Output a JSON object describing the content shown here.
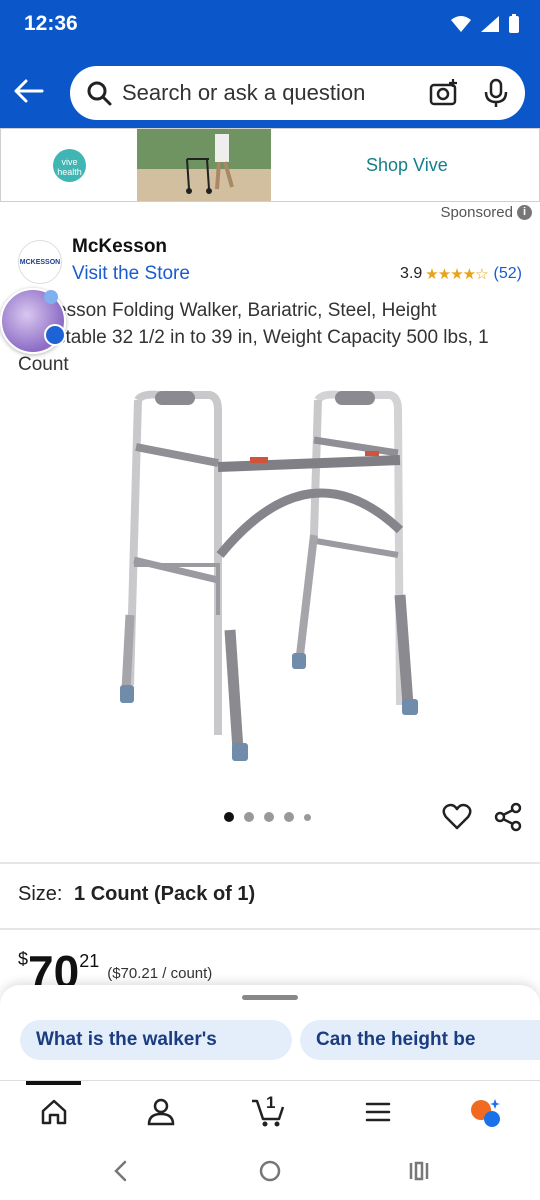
{
  "status_bar": {
    "time": "12:36"
  },
  "header": {
    "search_placeholder": "Search or ask a question"
  },
  "ad": {
    "brand_logo_text": "vive health",
    "cta": "Shop Vive",
    "sponsored_label": "Sponsored"
  },
  "seller": {
    "logo_text": "MCKESSON",
    "name": "McKesson",
    "link": "Visit the Store"
  },
  "rating": {
    "score": "3.9",
    "stars": "★★★★☆",
    "count": "(52)"
  },
  "product": {
    "title": "McKesson Folding Walker, Bariatric, Steel, Height Adjustable 32 1/2 in to 39 in, Weight Capacity 500 lbs, 1 Count",
    "image_count": 5,
    "active_image": 1
  },
  "size": {
    "label": "Size:",
    "value": "1 Count (Pack of 1)"
  },
  "price": {
    "currency": "$",
    "whole": "70",
    "cents": "21",
    "unit_price": "($70.21 / count)"
  },
  "assistant_chips": [
    {
      "label": "What is the walker's"
    },
    {
      "label": "Can the height be"
    }
  ],
  "bottom_nav": {
    "cart_count": "1",
    "items": [
      "home-icon",
      "account-icon",
      "cart-icon",
      "menu-icon",
      "assistant-icon"
    ]
  },
  "colors": {
    "header_blue": "#0b57c9",
    "link_blue": "#1a5bd0",
    "star_yellow": "#e8a317",
    "chip_bg": "#e4eefb",
    "vive_teal": "#3fb5b4"
  }
}
